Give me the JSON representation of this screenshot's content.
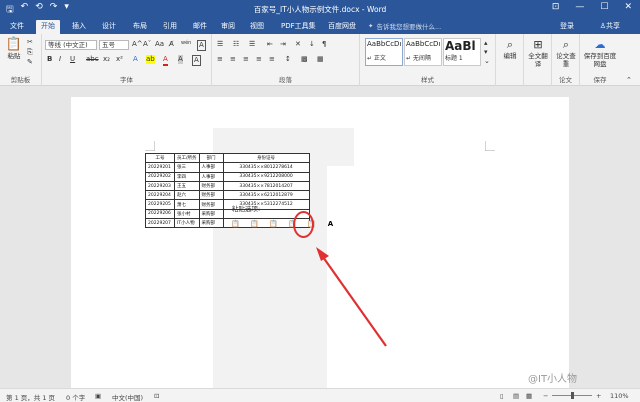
{
  "window": {
    "title": "百家号_IT小人物示例文件.docx - Word",
    "qat": {
      "save": "🖫",
      "undo": "↶",
      "redo": "↷",
      "autosave": "⟲",
      "more": "▾"
    },
    "controls": {
      "opts": "⊡",
      "min": "—",
      "max": "☐",
      "close": "✕"
    }
  },
  "tabs": [
    "文件",
    "开始",
    "插入",
    "设计",
    "布局",
    "引用",
    "邮件",
    "审阅",
    "视图",
    "PDF工具集",
    "百度网盘"
  ],
  "active_tab": "开始",
  "tellme": "告诉我您想要做什么...",
  "login": "登录",
  "share": "♙共享",
  "ribbon": {
    "clipboard": {
      "paste": "粘贴",
      "label": "剪贴板"
    },
    "font": {
      "name": "等线 (中文正)",
      "size": "五号",
      "label": "字体",
      "grow": "A^",
      "shrink": "Aˇ",
      "aa": "Aa",
      "clear": "A̸",
      "wen": "wén",
      "A": "A",
      "bold": "B",
      "italic": "I",
      "underline": "U",
      "strike": "abc",
      "sub": "x₂",
      "sup": "x²",
      "effects": "A",
      "highlight": "ab",
      "color": "A",
      "shade": "A",
      "border": "A"
    },
    "paragraph": {
      "label": "段落",
      "bullets": "☰",
      "numbering": "☷",
      "multi": "☰",
      "outdent": "⇤",
      "indent": "⇥",
      "asian": "✕",
      "sort": "↓",
      "marks": "¶",
      "left": "≡",
      "center": "≡",
      "right": "≡",
      "justify": "≡",
      "dist": "≡",
      "spacing": "↕",
      "fill": "▩",
      "borders": "▦"
    },
    "styles": {
      "label": "样式",
      "items": [
        {
          "preview": "AaBbCcDı",
          "name": "↵ 正文"
        },
        {
          "preview": "AaBbCcDı",
          "name": "↵ 无间隔"
        },
        {
          "preview": "AaBl",
          "name": "标题 1"
        }
      ]
    },
    "editing": {
      "label": "编辑"
    },
    "fulltext": {
      "label": "全文翻译"
    },
    "paper": {
      "label": "论文查重"
    },
    "save": {
      "label": "保存到百度网盘",
      "group": "保存",
      "group2": "论文"
    }
  },
  "doc_table": {
    "headers": [
      "工号",
      "员工/所务",
      "部门",
      "身份证号"
    ],
    "rows": [
      [
        "20229201",
        "张三",
        "人事部",
        "330435××8012278614"
      ],
      [
        "20229202",
        "李四",
        "人事部",
        "330435××9212208000"
      ],
      [
        "20229203",
        "王五",
        "财务部",
        "330435××7812014207"
      ],
      [
        "20229204",
        "赵六",
        "财务部",
        "330435××6212012879"
      ],
      [
        "20229205",
        "萧七",
        "财务部",
        "330435××5312274512"
      ],
      [
        "20229206",
        "张小村",
        "采购部",
        ""
      ],
      [
        "20229207",
        "IT小人物",
        "采购部",
        ""
      ]
    ]
  },
  "paste_options": {
    "label": "粘贴选项:",
    "icons": [
      "📋",
      "📋",
      "📋",
      "📋",
      "📋",
      "A"
    ]
  },
  "status": {
    "page": "第 1 页，共 1 页",
    "words": "0 个字",
    "lang": "中文(中国)",
    "zoom": "110%"
  },
  "watermark": "@IT小人物"
}
